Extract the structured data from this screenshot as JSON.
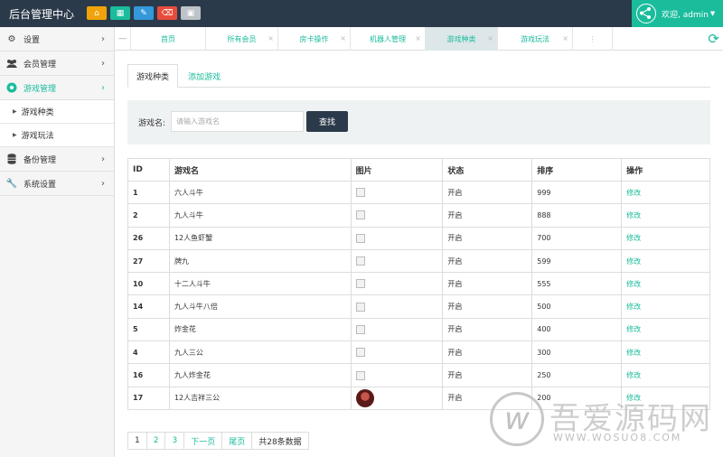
{
  "header": {
    "title": "后台管理中心",
    "quick_buttons": [
      {
        "name": "home-icon",
        "color": "#f0a30a"
      },
      {
        "name": "grid-icon",
        "color": "#1abc9c"
      },
      {
        "name": "pencil-icon",
        "color": "#3498db"
      },
      {
        "name": "trash-icon",
        "color": "#e74c3c"
      },
      {
        "name": "screen-icon",
        "color": "#bdc3c7"
      }
    ],
    "welcome": "欢迎, admin"
  },
  "sidebar": {
    "items": [
      {
        "label": "设置",
        "icon": "gears-icon"
      },
      {
        "label": "会员管理",
        "icon": "users-icon"
      },
      {
        "label": "游戏管理",
        "icon": "soccer-ball-icon",
        "active": true
      },
      {
        "label": "游戏种类",
        "sub": true
      },
      {
        "label": "游戏玩法",
        "sub": true
      },
      {
        "label": "备份管理",
        "icon": "database-icon"
      },
      {
        "label": "系统设置",
        "icon": "wrench-icon"
      }
    ]
  },
  "tabs": [
    {
      "label": "首页"
    },
    {
      "label": "所有会员"
    },
    {
      "label": "房卡操作"
    },
    {
      "label": "机器人管理"
    },
    {
      "label": "游戏种类",
      "current": true
    },
    {
      "label": "游戏玩法"
    }
  ],
  "subtabs": {
    "list": "游戏种类",
    "add": "添加游戏"
  },
  "search": {
    "label": "游戏名:",
    "placeholder": "请输入游戏名",
    "button": "查找"
  },
  "table": {
    "headers": [
      "ID",
      "游戏名",
      "图片",
      "状态",
      "排序",
      "操作"
    ],
    "rows": [
      {
        "id": "1",
        "name": "六人斗牛",
        "status": "开启",
        "sort": "999",
        "action": "修改"
      },
      {
        "id": "2",
        "name": "九人斗牛",
        "status": "开启",
        "sort": "888",
        "action": "修改"
      },
      {
        "id": "26",
        "name": "12人鱼虾蟹",
        "status": "开启",
        "sort": "700",
        "action": "修改"
      },
      {
        "id": "27",
        "name": "牌九",
        "status": "开启",
        "sort": "599",
        "action": "修改"
      },
      {
        "id": "10",
        "name": "十二人斗牛",
        "status": "开启",
        "sort": "555",
        "action": "修改"
      },
      {
        "id": "14",
        "name": "九人斗牛八倍",
        "status": "开启",
        "sort": "500",
        "action": "修改"
      },
      {
        "id": "5",
        "name": "炸金花",
        "status": "开启",
        "sort": "400",
        "action": "修改"
      },
      {
        "id": "4",
        "name": "九人三公",
        "status": "开启",
        "sort": "300",
        "action": "修改"
      },
      {
        "id": "16",
        "name": "九人炸金花",
        "status": "开启",
        "sort": "250",
        "action": "修改"
      },
      {
        "id": "17",
        "name": "12人吉祥三公",
        "status": "开启",
        "sort": "200",
        "action": "修改",
        "has_image": true
      }
    ]
  },
  "pager": {
    "pages": [
      "1",
      "2",
      "3"
    ],
    "next": "下一页",
    "last": "尾页",
    "total": "共28条数据"
  },
  "watermark": {
    "text": "吾爱源码网",
    "url": "WWW.WOSUO8.COM"
  }
}
